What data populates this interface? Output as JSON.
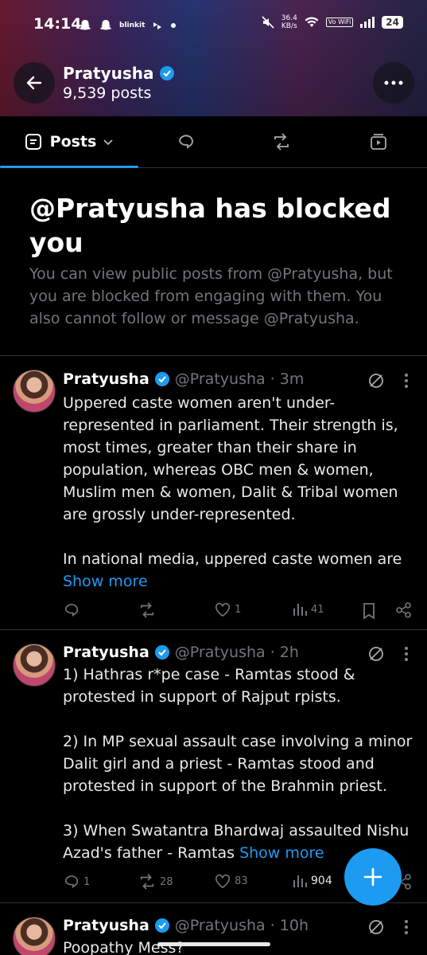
{
  "status_bar": {
    "time": "14:14",
    "app_label": "blinkit",
    "net_speed": "36.4",
    "net_unit": "KB/s",
    "volte": "Vo WiFi",
    "battery": "24"
  },
  "header": {
    "name": "Pratyusha",
    "post_count": "9,539 posts"
  },
  "tabs": {
    "posts_label": "Posts"
  },
  "blocked": {
    "title": "@Pratyusha has blocked you",
    "message": "You can view public posts from @Pratyusha, but you are blocked from engaging with them. You also cannot follow or message @Pratyusha."
  },
  "posts": [
    {
      "name": "Pratyusha",
      "handle": "@Pratyusha",
      "time": "· 3m",
      "body": "Uppered caste women aren't under-represented in parliament. Their strength is, most times, greater than their share in population, whereas OBC men & women, Muslim men & women, Dalit & Tribal women are grossly under-represented.\n\nIn national media, uppered caste women are",
      "show_more": "Show more",
      "replies": "",
      "reposts": "",
      "likes": "1",
      "views": "41"
    },
    {
      "name": "Pratyusha",
      "handle": "@Pratyusha",
      "time": "· 2h",
      "body": "1) Hathras r*pe case - Ramtas stood & protested in support of Rajput rpists.\n\n2) In MP sexual assault case involving a minor Dalit girl and a priest -  Ramtas stood and protested in support of the Brahmin priest.\n\n3) When Swatantra Bhardwaj assaulted Nishu Azad's father - Ramtas",
      "show_more": "Show more",
      "replies": "1",
      "reposts": "28",
      "likes": "83",
      "views": "904"
    },
    {
      "name": "Pratyusha",
      "handle": "@Pratyusha",
      "time": "· 10h",
      "body": "Poopathy Mess?"
    }
  ],
  "colors": {
    "accent": "#1d9bf0",
    "muted": "#71767b",
    "background": "#000000"
  }
}
